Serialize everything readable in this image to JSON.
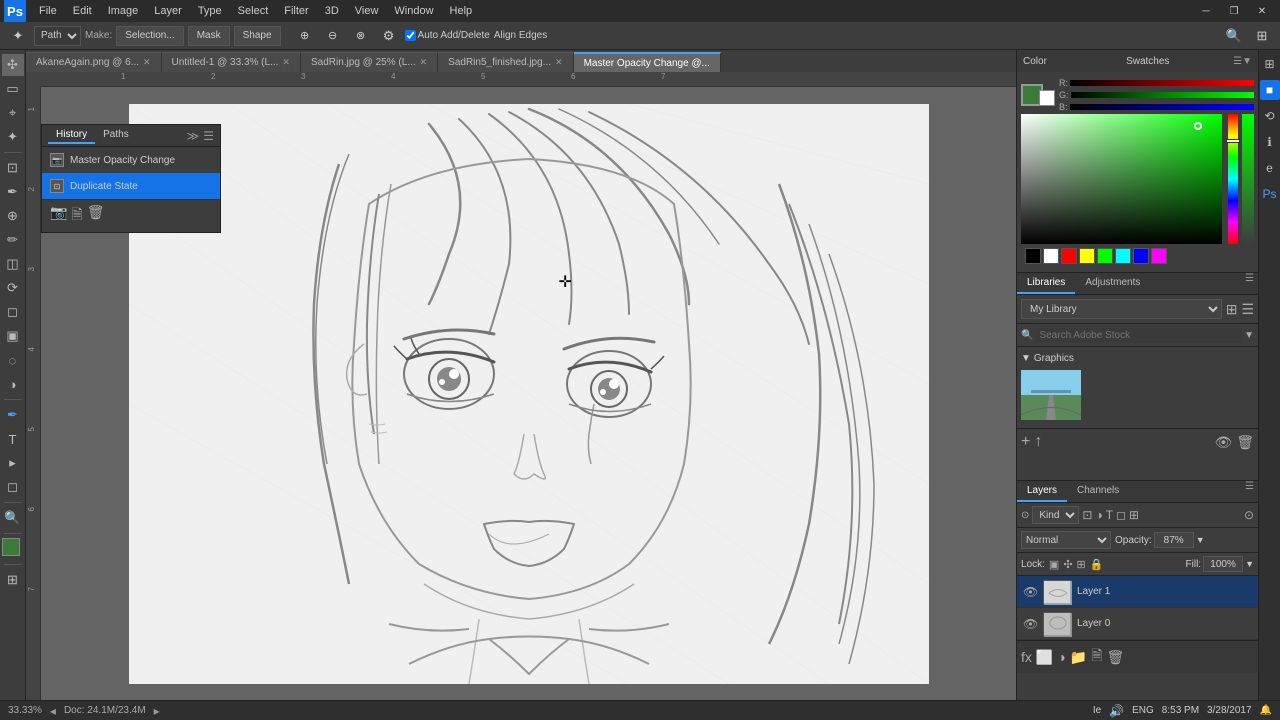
{
  "app": {
    "title": "Adobe Photoshop",
    "logo": "Ps"
  },
  "menubar": {
    "items": [
      "File",
      "Edit",
      "Image",
      "Layer",
      "Type",
      "Select",
      "Filter",
      "3D",
      "View",
      "Window",
      "Help"
    ]
  },
  "toolbar": {
    "tool_select": "Path",
    "make_label": "Make:",
    "make_options": [
      "Selection...",
      "Mask",
      "Shape"
    ],
    "auto_add_delete": "Auto Add/Delete",
    "align_edges": "Align Edges"
  },
  "tabs": [
    {
      "label": "AkaneAgain.png @ 6...",
      "active": false,
      "closeable": true
    },
    {
      "label": "Untitled-1 @ 33.3% (L...",
      "active": false,
      "closeable": true
    },
    {
      "label": "SadRin.jpg @ 25% (L...",
      "active": false,
      "closeable": true
    },
    {
      "label": "SadRin5_finished.jpg...",
      "active": false,
      "closeable": true
    },
    {
      "label": "Master Opacity Change @...",
      "active": true,
      "closeable": false
    }
  ],
  "history_panel": {
    "tabs": [
      {
        "label": "History",
        "active": true
      },
      {
        "label": "Paths",
        "active": false
      }
    ],
    "items": [
      {
        "label": "Master Opacity Change",
        "selected": false,
        "icon": "camera"
      },
      {
        "label": "Duplicate State",
        "selected": true,
        "icon": "duplicate"
      }
    ],
    "actions": [
      "new-snapshot",
      "new-doc",
      "delete"
    ]
  },
  "color_panel": {
    "title": "Color",
    "swatches_title": "Swatches",
    "fg_color": "#3a7a3a",
    "bg_color": "#ffffff"
  },
  "libraries_panel": {
    "tabs": [
      "Libraries",
      "Adjustments"
    ],
    "active_tab": "Libraries",
    "library_select": "My Library",
    "search_placeholder": "Search Adobe Stock",
    "graphics_label": "Graphics",
    "thumbnail_alt": "landscape road photo"
  },
  "layers_panel": {
    "tabs": [
      "Layers",
      "Channels"
    ],
    "active_tab": "Layers",
    "blend_mode": "Normal",
    "opacity_label": "Opacity:",
    "opacity_value": "87%",
    "lock_label": "Lock:",
    "fill_label": "Fill:",
    "fill_value": "100%",
    "layers": [
      {
        "name": "Layer 1",
        "visible": true,
        "selected": true
      },
      {
        "name": "Layer 0",
        "visible": true,
        "selected": false
      }
    ]
  },
  "statusbar": {
    "zoom": "33.33%",
    "doc_info": "Doc: 24.1M/23.4M"
  },
  "taskbar": {
    "time": "8:53 PM",
    "date": "3/28/2017",
    "lang": "ENG",
    "ie_label": "Ie"
  }
}
